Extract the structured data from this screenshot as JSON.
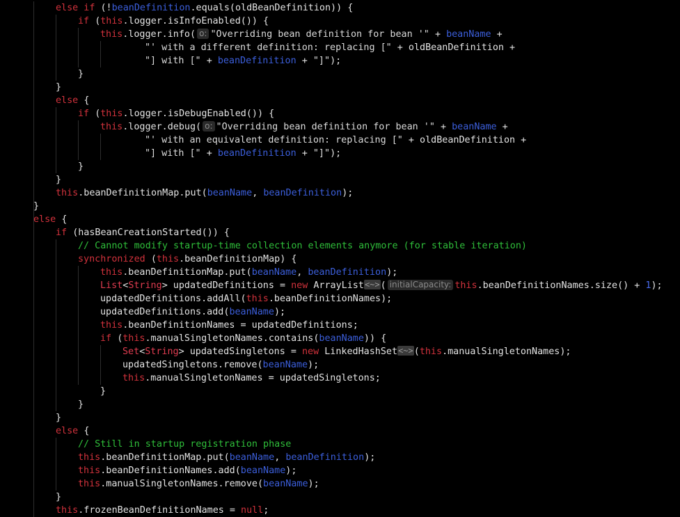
{
  "editor": {
    "theme": {
      "background": "#000000",
      "keyword": "#d2323c",
      "field": "#3c5fdc",
      "comment": "#2fbf3a",
      "text": "#e4e4e4"
    },
    "lines": [
      [
        {
          "k": "kw",
          "t": "else if "
        },
        {
          "k": "pl",
          "t": "(!"
        },
        {
          "k": "fl",
          "t": "beanDefinition"
        },
        {
          "k": "pl",
          "t": ".equals(oldBeanDefinition)) {"
        }
      ],
      [
        {
          "k": "kw",
          "t": "if "
        },
        {
          "k": "pl",
          "t": "("
        },
        {
          "k": "kw",
          "t": "this"
        },
        {
          "k": "pl",
          "t": ".logger.isInfoEnabled()) {"
        }
      ],
      [
        {
          "k": "kw",
          "t": "this"
        },
        {
          "k": "pl",
          "t": ".logger.info("
        },
        {
          "k": "hint",
          "t": "o:"
        },
        {
          "k": "st",
          "t": "\"Overriding bean definition for bean '\" "
        },
        {
          "k": "pl",
          "t": "+ "
        },
        {
          "k": "fl",
          "t": "beanName"
        },
        {
          "k": "pl",
          "t": " +"
        }
      ],
      [
        {
          "k": "st",
          "t": "\"' with a different definition: replacing [\" "
        },
        {
          "k": "pl",
          "t": "+ oldBeanDefinition +"
        }
      ],
      [
        {
          "k": "st",
          "t": "\"] with [\" "
        },
        {
          "k": "pl",
          "t": "+ "
        },
        {
          "k": "fl",
          "t": "beanDefinition"
        },
        {
          "k": "pl",
          "t": " + "
        },
        {
          "k": "st",
          "t": "\"]\""
        },
        {
          "k": "pl",
          "t": ");"
        }
      ],
      [
        {
          "k": "pl",
          "t": "}"
        }
      ],
      [
        {
          "k": "pl",
          "t": "}"
        }
      ],
      [
        {
          "k": "kw",
          "t": "else "
        },
        {
          "k": "pl",
          "t": "{"
        }
      ],
      [
        {
          "k": "kw",
          "t": "if "
        },
        {
          "k": "pl",
          "t": "("
        },
        {
          "k": "kw",
          "t": "this"
        },
        {
          "k": "pl",
          "t": ".logger.isDebugEnabled()) {"
        }
      ],
      [
        {
          "k": "kw",
          "t": "this"
        },
        {
          "k": "pl",
          "t": ".logger.debug("
        },
        {
          "k": "hint",
          "t": "o:"
        },
        {
          "k": "st",
          "t": "\"Overriding bean definition for bean '\" "
        },
        {
          "k": "pl",
          "t": "+ "
        },
        {
          "k": "fl",
          "t": "beanName"
        },
        {
          "k": "pl",
          "t": " +"
        }
      ],
      [
        {
          "k": "st",
          "t": "\"' with an equivalent definition: replacing [\" "
        },
        {
          "k": "pl",
          "t": "+ oldBeanDefinition +"
        }
      ],
      [
        {
          "k": "st",
          "t": "\"] with [\" "
        },
        {
          "k": "pl",
          "t": "+ "
        },
        {
          "k": "fl",
          "t": "beanDefinition"
        },
        {
          "k": "pl",
          "t": " + "
        },
        {
          "k": "st",
          "t": "\"]\""
        },
        {
          "k": "pl",
          "t": ");"
        }
      ],
      [
        {
          "k": "pl",
          "t": "}"
        }
      ],
      [
        {
          "k": "pl",
          "t": "}"
        }
      ],
      [
        {
          "k": "kw",
          "t": "this"
        },
        {
          "k": "pl",
          "t": ".beanDefinitionMap.put("
        },
        {
          "k": "fl",
          "t": "beanName"
        },
        {
          "k": "pl",
          "t": ", "
        },
        {
          "k": "fl",
          "t": "beanDefinition"
        },
        {
          "k": "pl",
          "t": ");"
        }
      ],
      [
        {
          "k": "pl",
          "t": "}"
        }
      ],
      [
        {
          "k": "kw",
          "t": "else "
        },
        {
          "k": "pl",
          "t": "{"
        }
      ],
      [
        {
          "k": "kw",
          "t": "if "
        },
        {
          "k": "pl",
          "t": "(hasBeanCreationStarted()) {"
        }
      ],
      [
        {
          "k": "cm",
          "t": "// Cannot modify startup-time collection elements anymore (for stable iteration)"
        }
      ],
      [
        {
          "k": "kw",
          "t": "synchronized "
        },
        {
          "k": "pl",
          "t": "("
        },
        {
          "k": "kw",
          "t": "this"
        },
        {
          "k": "pl",
          "t": ".beanDefinitionMap) {"
        }
      ],
      [
        {
          "k": "kw",
          "t": "this"
        },
        {
          "k": "pl",
          "t": ".beanDefinitionMap.put("
        },
        {
          "k": "fl",
          "t": "beanName"
        },
        {
          "k": "pl",
          "t": ", "
        },
        {
          "k": "fl",
          "t": "beanDefinition"
        },
        {
          "k": "pl",
          "t": ");"
        }
      ],
      [
        {
          "k": "ty",
          "t": "List"
        },
        {
          "k": "pl",
          "t": "<"
        },
        {
          "k": "ty",
          "t": "String"
        },
        {
          "k": "pl",
          "t": "> updatedDefinitions = "
        },
        {
          "k": "kw",
          "t": "new "
        },
        {
          "k": "pl",
          "t": "ArrayList"
        },
        {
          "k": "fold",
          "t": "<~>"
        },
        {
          "k": "pl",
          "t": "("
        },
        {
          "k": "hint",
          "t": "initialCapacity:"
        },
        {
          "k": "kw",
          "t": "this"
        },
        {
          "k": "pl",
          "t": ".beanDefinitionNames.size() + "
        },
        {
          "k": "num",
          "t": "1"
        },
        {
          "k": "pl",
          "t": ");"
        }
      ],
      [
        {
          "k": "pl",
          "t": "updatedDefinitions.addAll("
        },
        {
          "k": "kw",
          "t": "this"
        },
        {
          "k": "pl",
          "t": ".beanDefinitionNames);"
        }
      ],
      [
        {
          "k": "pl",
          "t": "updatedDefinitions.add("
        },
        {
          "k": "fl",
          "t": "beanName"
        },
        {
          "k": "pl",
          "t": ");"
        }
      ],
      [
        {
          "k": "kw",
          "t": "this"
        },
        {
          "k": "pl",
          "t": ".beanDefinitionNames = updatedDefinitions;"
        }
      ],
      [
        {
          "k": "kw",
          "t": "if "
        },
        {
          "k": "pl",
          "t": "("
        },
        {
          "k": "kw",
          "t": "this"
        },
        {
          "k": "pl",
          "t": ".manualSingletonNames.contains("
        },
        {
          "k": "fl",
          "t": "beanName"
        },
        {
          "k": "pl",
          "t": ")) {"
        }
      ],
      [
        {
          "k": "ty",
          "t": "Set"
        },
        {
          "k": "pl",
          "t": "<"
        },
        {
          "k": "ty",
          "t": "String"
        },
        {
          "k": "pl",
          "t": "> updatedSingletons = "
        },
        {
          "k": "kw",
          "t": "new "
        },
        {
          "k": "pl",
          "t": "LinkedHashSet"
        },
        {
          "k": "fold",
          "t": "<~>"
        },
        {
          "k": "pl",
          "t": "("
        },
        {
          "k": "kw",
          "t": "this"
        },
        {
          "k": "pl",
          "t": ".manualSingletonNames);"
        }
      ],
      [
        {
          "k": "pl",
          "t": "updatedSingletons.remove("
        },
        {
          "k": "fl",
          "t": "beanName"
        },
        {
          "k": "pl",
          "t": ");"
        }
      ],
      [
        {
          "k": "kw",
          "t": "this"
        },
        {
          "k": "pl",
          "t": ".manualSingletonNames = updatedSingletons;"
        }
      ],
      [
        {
          "k": "pl",
          "t": "}"
        }
      ],
      [
        {
          "k": "pl",
          "t": "}"
        }
      ],
      [
        {
          "k": "pl",
          "t": "}"
        }
      ],
      [
        {
          "k": "kw",
          "t": "else "
        },
        {
          "k": "pl",
          "t": "{"
        }
      ],
      [
        {
          "k": "cm",
          "t": "// Still in startup registration phase"
        }
      ],
      [
        {
          "k": "kw",
          "t": "this"
        },
        {
          "k": "pl",
          "t": ".beanDefinitionMap.put("
        },
        {
          "k": "fl",
          "t": "beanName"
        },
        {
          "k": "pl",
          "t": ", "
        },
        {
          "k": "fl",
          "t": "beanDefinition"
        },
        {
          "k": "pl",
          "t": ");"
        }
      ],
      [
        {
          "k": "kw",
          "t": "this"
        },
        {
          "k": "pl",
          "t": ".beanDefinitionNames.add("
        },
        {
          "k": "fl",
          "t": "beanName"
        },
        {
          "k": "pl",
          "t": ");"
        }
      ],
      [
        {
          "k": "kw",
          "t": "this"
        },
        {
          "k": "pl",
          "t": ".manualSingletonNames.remove("
        },
        {
          "k": "fl",
          "t": "beanName"
        },
        {
          "k": "pl",
          "t": ");"
        }
      ],
      [
        {
          "k": "pl",
          "t": "}"
        }
      ],
      [
        {
          "k": "kw",
          "t": "this"
        },
        {
          "k": "pl",
          "t": ".frozenBeanDefinitionNames = "
        },
        {
          "k": "kw",
          "t": "null"
        },
        {
          "k": "pl",
          "t": ";"
        }
      ]
    ]
  }
}
